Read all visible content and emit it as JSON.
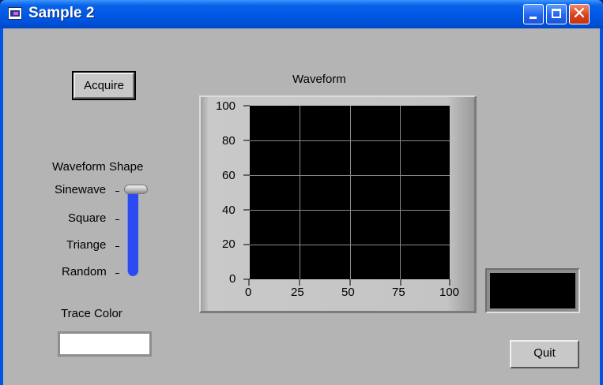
{
  "window": {
    "title": "Sample 2",
    "controls": {
      "minimize": "minimize-icon",
      "maximize": "maximize-icon",
      "close": "close-icon"
    }
  },
  "acquire": {
    "label": "Acquire"
  },
  "waveform_shape": {
    "label": "Waveform Shape",
    "options": [
      "Sinewave",
      "Square",
      "Triange",
      "Random"
    ],
    "selected": "Sinewave"
  },
  "trace_color": {
    "label": "Trace Color",
    "value_color": "#ffffff"
  },
  "graph": {
    "title": "Waveform",
    "background": "#000000",
    "grid_color": "#8a8a8a",
    "y_ticks": [
      "100",
      "80",
      "60",
      "40",
      "20",
      "0"
    ],
    "x_ticks": [
      "0",
      "25",
      "50",
      "75",
      "100"
    ]
  },
  "indicator": {
    "color": "#000000"
  },
  "quit": {
    "label": "Quit"
  },
  "colors": {
    "titlebar": "#0058e6",
    "panel": "#b4b4b4",
    "slider_fill": "#2b4af0"
  }
}
